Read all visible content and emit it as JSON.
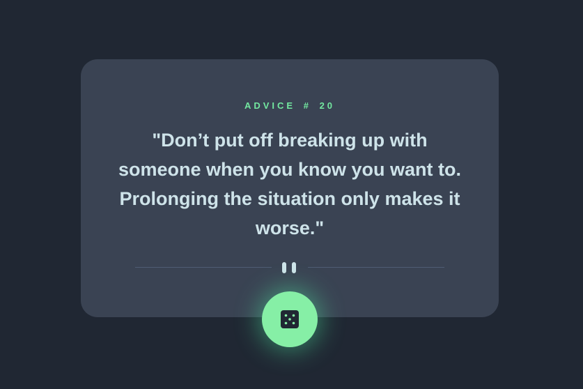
{
  "advice": {
    "label": "ADVICE",
    "separator": "#",
    "number": "20",
    "quote": "\"Don’t put off breaking up with someone when you know you want to. Prolonging the situation only makes it worse.\""
  },
  "icons": {
    "divider": "pause-icon",
    "button": "dice-icon"
  },
  "colors": {
    "background": "#202733",
    "card": "#3a4353",
    "accent": "#73e8a0",
    "text": "#cee3e9",
    "button": "#86efa6"
  }
}
